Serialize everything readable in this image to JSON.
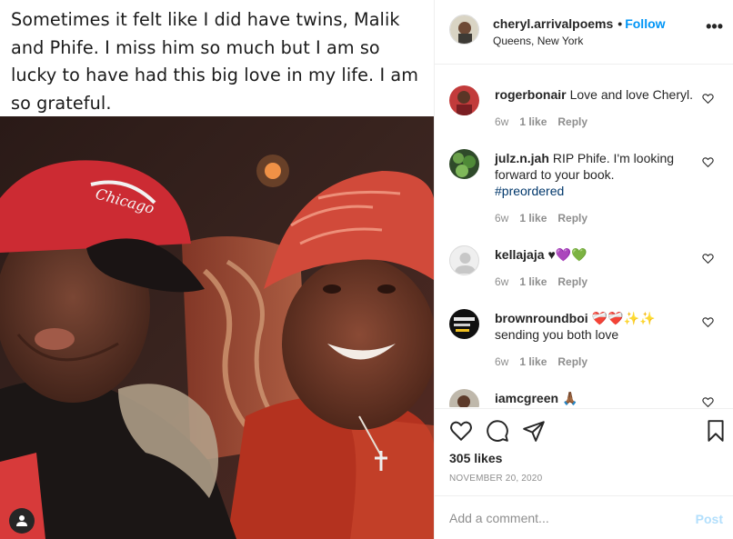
{
  "post": {
    "caption_image_text": "Sometimes it felt like I did have twins, Malik and Phife. I miss him so much but I am so lucky to have had this big love in my life. I am so grateful.",
    "user_tag_icon": "person-icon"
  },
  "header": {
    "username": "cheryl.arrivalpoems",
    "separator": "•",
    "follow_label": "Follow",
    "location": "Queens, New York",
    "more_icon": "more-horizontal-icon",
    "more_label": "•••"
  },
  "comments": [
    {
      "username": "rogerbonair",
      "text": "Love and love Cheryl.",
      "age": "6w",
      "likes": "1 like",
      "reply": "Reply"
    },
    {
      "username": "julz.n.jah",
      "text": "RIP Phife. I'm looking forward to your book.",
      "hashtag": "#preordered",
      "age": "6w",
      "likes": "1 like",
      "reply": "Reply"
    },
    {
      "username": "kellajaja",
      "text": "♥💜💚",
      "age": "6w",
      "likes": "1 like",
      "reply": "Reply"
    },
    {
      "username": "brownroundboi",
      "text": "❤️‍🩹❤️‍🩹✨✨",
      "text2": "sending you both love",
      "age": "6w",
      "likes": "1 like",
      "reply": "Reply"
    },
    {
      "username": "iamcgreen",
      "text": "🙏🏾"
    }
  ],
  "actions": {
    "like_icon": "heart-icon",
    "comment_icon": "comment-icon",
    "share_icon": "paper-plane-icon",
    "save_icon": "bookmark-icon",
    "likes_count": "305 likes",
    "date": "NOVEMBER 20, 2020"
  },
  "add_comment": {
    "placeholder": "Add a comment...",
    "value": "",
    "post_label": "Post"
  }
}
